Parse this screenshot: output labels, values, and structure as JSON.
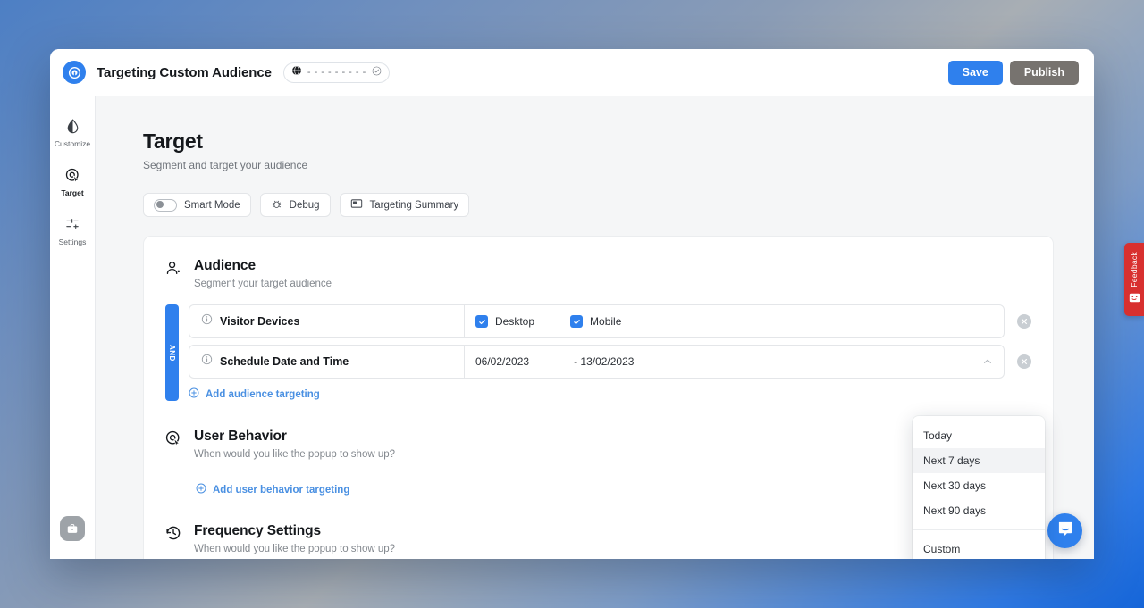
{
  "topbar": {
    "logo_icon": "brand-logo-icon",
    "title": "Targeting Custom Audience",
    "url_pill": {
      "globe_icon": "globe-icon",
      "dashes": "- - - - - - - - -",
      "check_icon": "check-circle-icon"
    },
    "save_label": "Save",
    "publish_label": "Publish",
    "save_color": "#2f80ed",
    "publish_color": "#77736f"
  },
  "sidebar": {
    "items": [
      {
        "label": "Customize",
        "icon": "contrast-droplet-icon",
        "active": false
      },
      {
        "label": "Target",
        "icon": "target-cursor-icon",
        "active": true
      },
      {
        "label": "Settings",
        "icon": "sliders-icon",
        "active": false
      }
    ],
    "fab_icon": "briefcase-icon"
  },
  "page": {
    "title": "Target",
    "subtitle": "Segment and target your audience"
  },
  "toolbar": {
    "smart_mode_label": "Smart Mode",
    "smart_mode_on": false,
    "debug_label": "Debug",
    "debug_icon": "bug-icon",
    "summary_label": "Targeting Summary",
    "summary_icon": "panel-icon"
  },
  "audience": {
    "title": "Audience",
    "subtitle": "Segment your target audience",
    "icon": "people-icon",
    "group_operator": "AND",
    "rules": [
      {
        "label": "Visitor Devices",
        "info_icon": "info-icon",
        "type": "checkboxes",
        "options": [
          {
            "label": "Desktop",
            "checked": true
          },
          {
            "label": "Mobile",
            "checked": true
          }
        ],
        "delete_icon": "close-circle-icon"
      },
      {
        "label": "Schedule Date and Time",
        "info_icon": "info-icon",
        "type": "daterange",
        "start_date": "06/02/2023",
        "end_date": "- 13/02/2023",
        "chevron_icon": "chevron-up-icon",
        "delete_icon": "close-circle-icon"
      }
    ],
    "add_link": "Add audience targeting",
    "add_icon": "plus-circle-icon"
  },
  "date_dropdown": {
    "items": [
      {
        "label": "Today",
        "highlighted": false
      },
      {
        "label": "Next 7 days",
        "highlighted": true
      },
      {
        "label": "Next 30 days",
        "highlighted": false
      },
      {
        "label": "Next 90 days",
        "highlighted": false
      }
    ],
    "custom_label": "Custom"
  },
  "user_behavior": {
    "title": "User Behavior",
    "subtitle": "When would you like the popup to show up?",
    "icon": "target-cursor-icon",
    "add_link": "Add user behavior targeting",
    "add_icon": "plus-circle-icon"
  },
  "frequency": {
    "title": "Frequency Settings",
    "subtitle": "When would you like the popup to show up?",
    "icon": "history-clock-icon"
  },
  "feedback": {
    "label": "Feedback",
    "icon": "smiley-icon",
    "color": "#d8302f"
  },
  "intercom": {
    "icon": "chat-bubble-icon",
    "color": "#2f80ed"
  }
}
